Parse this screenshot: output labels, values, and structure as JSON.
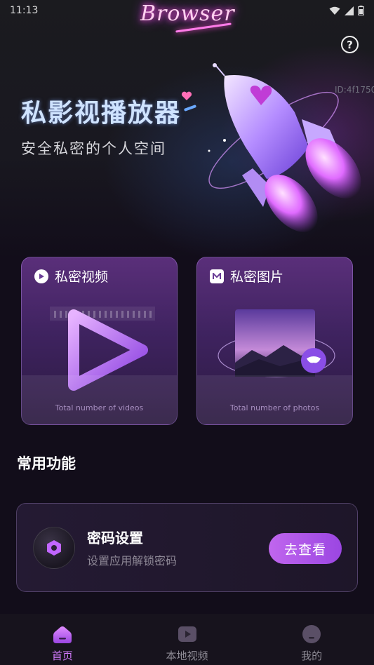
{
  "status_bar": {
    "time": "11:13"
  },
  "brand": {
    "logo_text": "Browser"
  },
  "header": {
    "help_icon": "question-circle-icon",
    "device_id": "ID:4f1750"
  },
  "hero": {
    "title": "私影视播放器",
    "subtitle": "安全私密的个人空间"
  },
  "cards": [
    {
      "label": "私密视频",
      "icon": "play-circle-icon",
      "count_label": "Total number of videos"
    },
    {
      "label": "私密图片",
      "icon": "image-icon",
      "count_label": "Total number of photos"
    }
  ],
  "section": {
    "title": "常用功能"
  },
  "feature": {
    "title": "密码设置",
    "description": "设置应用解锁密码",
    "button_label": "去查看",
    "icon": "lock-hexagon-icon"
  },
  "tabbar": {
    "items": [
      {
        "label": "首页",
        "icon": "home-icon",
        "active": true
      },
      {
        "label": "本地视频",
        "icon": "video-icon",
        "active": false
      },
      {
        "label": "我的",
        "icon": "profile-icon",
        "active": false
      }
    ]
  },
  "colors": {
    "accent": "#d47bff",
    "background": "#120d1a",
    "card_purple": "#4a2a6c",
    "button_gradient_start": "#c066ee"
  }
}
